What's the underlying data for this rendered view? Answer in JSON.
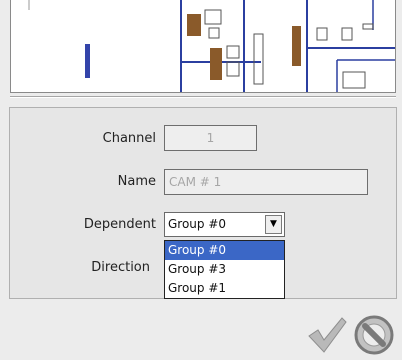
{
  "form": {
    "channel_label": "Channel",
    "channel_value": "1",
    "name_label": "Name",
    "name_value": "CAM # 1",
    "dependent_label": "Dependent",
    "dependent_selected": "Group #0",
    "direction_label": "Direction"
  },
  "dependent_options": [
    {
      "label": "Group #0",
      "selected": true
    },
    {
      "label": "Group #3",
      "selected": false
    },
    {
      "label": "Group #1",
      "selected": false
    }
  ],
  "actions": {
    "confirm_icon": "checkmark-icon",
    "cancel_icon": "no-entry-icon"
  },
  "colors": {
    "selection": "#3b67c6",
    "panel_bg": "#e6e6e6",
    "camera_marker": "#3344aa"
  }
}
